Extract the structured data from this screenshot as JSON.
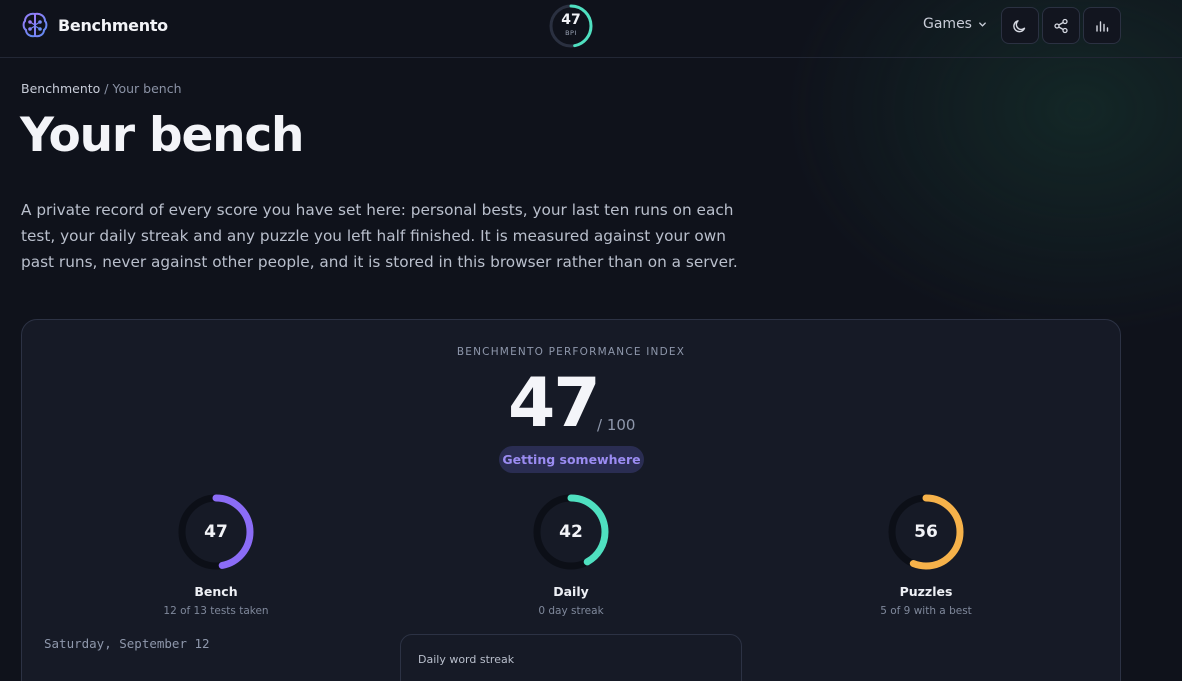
{
  "header": {
    "brand_name": "Benchmento",
    "bpi_value": "47",
    "bpi_label": "BPI",
    "bpi_progress": 0.47,
    "games_label": "Games",
    "buttons": [
      "moon-icon",
      "share-icon",
      "stats-icon"
    ]
  },
  "breadcrumb": {
    "home": "Benchmento",
    "separator": " / ",
    "current": "Your bench"
  },
  "page": {
    "title": "Your bench",
    "intro": "A private record of every score you have set here: personal bests, your last ten runs on each test, your daily streak and any puzzle you left half finished. It is measured against your own past runs, never against other people, and it is stored in this browser rather than on a server."
  },
  "index_card": {
    "caption": "BENCHMENTO PERFORMANCE INDEX",
    "score": "47",
    "max": "/ 100",
    "verdict": "Getting somewhere",
    "metrics": [
      {
        "value": "47",
        "progress": 0.47,
        "name": "Bench",
        "sub": "12 of 13 tests taken",
        "color": "#8b6cf6"
      },
      {
        "value": "42",
        "progress": 0.42,
        "name": "Daily",
        "sub": "0 day streak",
        "color": "#4fe0c0"
      },
      {
        "value": "56",
        "progress": 0.56,
        "name": "Puzzles",
        "sub": "5 of 9 with a best",
        "color": "#f6b24a"
      }
    ],
    "date": "Saturday, September 12",
    "streak_title": "Daily word streak"
  },
  "colors": {
    "background": "#0f121b",
    "accent_purple": "#8b6cf6",
    "accent_teal": "#4fe0c0",
    "accent_orange": "#f6b24a"
  }
}
